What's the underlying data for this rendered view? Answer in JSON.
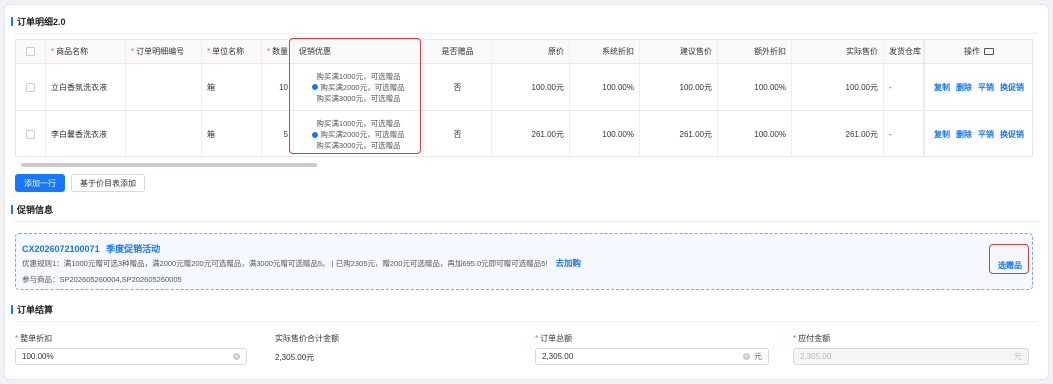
{
  "order_detail": {
    "title": "订单明细2.0",
    "headers": {
      "product_name": "商品名称",
      "detail_no": "订单明细编号",
      "unit": "单位名称",
      "qty": "数量",
      "promo": "促销优惠",
      "is_gift": "是否赠品",
      "orig_price": "原价",
      "sys_discount": "系统折扣",
      "suggest_price": "建议售价",
      "extra_discount": "额外折扣",
      "actual_price": "实际售价",
      "warehouse": "发货仓库",
      "ops": "操作"
    },
    "rows": [
      {
        "product_name": "立白香氛洗衣液",
        "detail_no": "",
        "unit": "箱",
        "qty": "10",
        "promo_lines": [
          "购买满1000元，可选赠品",
          "购买满2000元，可选赠品",
          "购买满3000元，可选赠品"
        ],
        "is_gift": "否",
        "orig_price": "100.00元",
        "sys_discount": "100.00%",
        "suggest_price": "100.00元",
        "extra_discount": "100.00%",
        "actual_price": "100.00元",
        "warehouse": "-"
      },
      {
        "product_name": "李白馨香洗衣液",
        "detail_no": "",
        "unit": "箱",
        "qty": "5",
        "promo_lines": [
          "购买满1000元，可选赠品",
          "购买满2000元，可选赠品",
          "购买满3000元，可选赠品"
        ],
        "is_gift": "否",
        "orig_price": "261.00元",
        "sys_discount": "100.00%",
        "suggest_price": "261.00元",
        "extra_discount": "100.00%",
        "actual_price": "261.00元",
        "warehouse": "-"
      }
    ],
    "row_actions": [
      "复制",
      "删除",
      "平销",
      "换促销"
    ],
    "add_row_label": "添加一行",
    "add_from_pricelist_label": "基于价目表添加"
  },
  "promotion": {
    "title": "促销信息",
    "activity_code": "CX2026072100071",
    "activity_name": "季度促销活动",
    "rule_text": "优惠规则1：满1000元赠可选3种赠品，满2000元赠200元可选赠品，满3000元赠可选赠品5。 | 已购2305元，赠200元可选赠品，再加695.0元即可赠可选赠品5!",
    "add_more_label": "去加购",
    "products_text": "参与商品：SP202605260004,SP202605260005",
    "select_gift_label": "选赠品"
  },
  "settlement": {
    "title": "订单结算",
    "whole_discount_label": "整单折扣",
    "whole_discount_value": "100.00%",
    "actual_total_label": "实际售价合计金额",
    "actual_total_value": "2,305.00元",
    "order_total_label": "订单总额",
    "order_total_value": "2,305.00",
    "order_total_suffix": "元",
    "payable_label": "应付金额",
    "payable_value": "2,305.00",
    "payable_suffix": "元"
  },
  "colors": {
    "accent": "#1677ff",
    "highlight": "#e23a3a",
    "required": "#ff4d4f"
  }
}
